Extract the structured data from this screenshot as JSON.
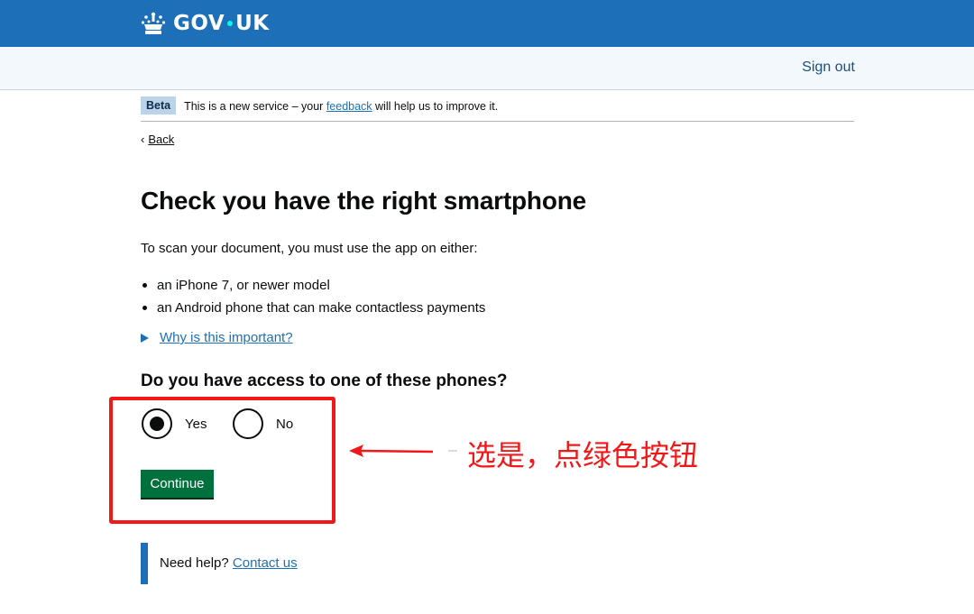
{
  "header": {
    "logo": "GOV·UK",
    "logo_parts": [
      "GOV",
      "UK"
    ]
  },
  "service_nav": {
    "sign_out": "Sign out"
  },
  "phase_banner": {
    "tag": "Beta",
    "text_before": "This is a new service – your",
    "link": "feedback",
    "text_after": "will help us to improve it."
  },
  "back": {
    "label": "Back"
  },
  "main": {
    "title": "Check you have the right smartphone",
    "intro": "To scan your document, you must use the app on either:",
    "bullets": [
      "an iPhone 7, or newer model",
      "an Android phone that can make contactless payments"
    ],
    "details_summary": "Why is this important?",
    "question": "Do you have access to one of these phones?",
    "options": [
      {
        "label": "Yes",
        "selected": true
      },
      {
        "label": "No",
        "selected": false
      }
    ],
    "continue_label": "Continue"
  },
  "help": {
    "text": "Need help?",
    "link": "Contact us"
  },
  "annotation": {
    "text": "选是，点绿色按钮",
    "color": "#f01818"
  },
  "colors": {
    "brand_blue": "#1d70b8",
    "button_green": "#00703c",
    "text": "#0b0c0c"
  }
}
